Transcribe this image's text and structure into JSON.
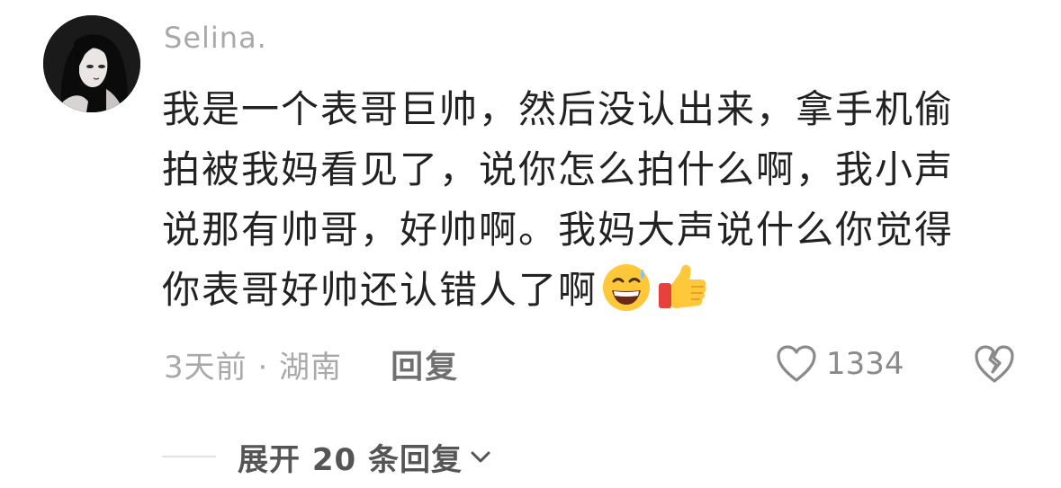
{
  "comment": {
    "username": "Selina.",
    "text_lines": [
      "我是一个表哥巨帅，然后没认出来，拿手机偷",
      "拍被我妈看见了，说你怎么拍什么啊，我小声",
      "说那有帅哥，好帅啊。我妈大声说什么你觉得",
      "你表哥好帅还认错人了啊"
    ],
    "emojis": [
      "grinning-sweat-face-icon",
      "thumbs-up-icon"
    ],
    "time_location": "3天前 · 湖南",
    "reply_label": "回复",
    "like_count": "1334"
  },
  "expand": {
    "label": "展开 20 条回复"
  },
  "icons": {
    "like": "heart-outline-icon",
    "dislike": "broken-heart-icon",
    "expand": "chevron-down-icon"
  },
  "colors": {
    "username": "#a9a9a9",
    "text": "#222222",
    "meta": "#a9a9a9",
    "reply": "#707070",
    "icon": "#8a8a8a",
    "expand": "#555555",
    "emoji_yellow": "#ffc83a",
    "emoji_red": "#e8403a"
  }
}
